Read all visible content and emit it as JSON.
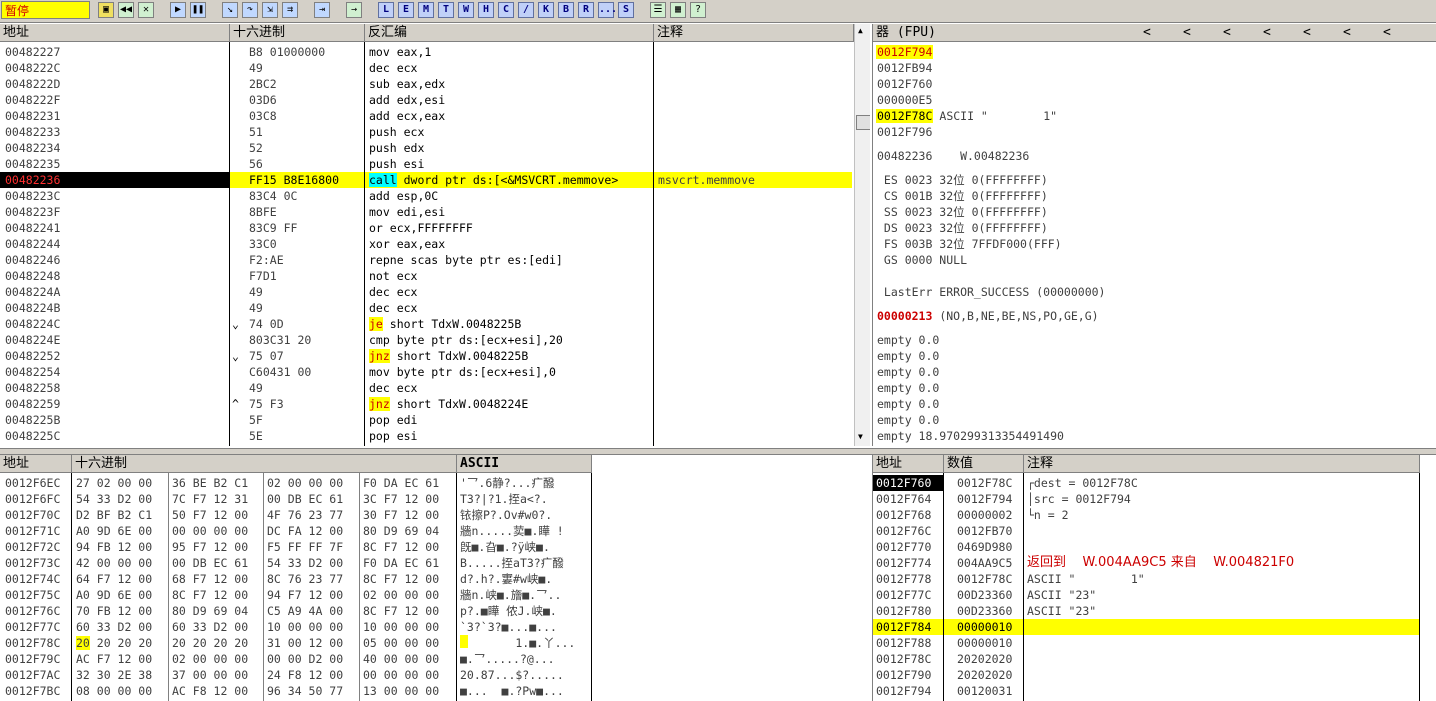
{
  "toolbar": {
    "status": "暂停",
    "letter_buttons": [
      "L",
      "E",
      "M",
      "T",
      "W",
      "H",
      "C",
      "/",
      "K",
      "B",
      "R",
      "...",
      "S"
    ]
  },
  "disasm": {
    "headers": {
      "addr": "地址",
      "hex": "十六进制",
      "asm": "反汇编",
      "comment": "注释"
    },
    "rows": [
      {
        "addr": "00482227",
        "mark": "",
        "hex": "B8 01000000",
        "op": "",
        "asm": "mov eax,1",
        "comment": ""
      },
      {
        "addr": "0048222C",
        "mark": "",
        "hex": "49",
        "op": "",
        "asm": "dec ecx",
        "comment": ""
      },
      {
        "addr": "0048222D",
        "mark": "",
        "hex": "2BC2",
        "op": "",
        "asm": "sub eax,edx",
        "comment": ""
      },
      {
        "addr": "0048222F",
        "mark": "",
        "hex": "03D6",
        "op": "",
        "asm": "add edx,esi",
        "comment": ""
      },
      {
        "addr": "00482231",
        "mark": "",
        "hex": "03C8",
        "op": "",
        "asm": "add ecx,eax",
        "comment": ""
      },
      {
        "addr": "00482233",
        "mark": "",
        "hex": "51",
        "op": "",
        "asm": "push ecx",
        "comment": ""
      },
      {
        "addr": "00482234",
        "mark": "",
        "hex": "52",
        "op": "",
        "asm": "push edx",
        "comment": ""
      },
      {
        "addr": "00482235",
        "mark": "",
        "hex": "56",
        "op": "",
        "asm": "push esi",
        "comment": ""
      },
      {
        "addr": "00482236",
        "mark": "",
        "hex": "FF15 B8E16800",
        "op": "call",
        "asm": " dword ptr ds:[<&MSVCRT.memmove>",
        "comment": "msvcrt.memmove"
      },
      {
        "addr": "0048223C",
        "mark": "",
        "hex": "83C4 0C",
        "op": "",
        "asm": "add esp,0C",
        "comment": ""
      },
      {
        "addr": "0048223F",
        "mark": "",
        "hex": "8BFE",
        "op": "",
        "asm": "mov edi,esi",
        "comment": ""
      },
      {
        "addr": "00482241",
        "mark": "",
        "hex": "83C9 FF",
        "op": "",
        "asm": "or ecx,FFFFFFFF",
        "comment": ""
      },
      {
        "addr": "00482244",
        "mark": "",
        "hex": "33C0",
        "op": "",
        "asm": "xor eax,eax",
        "comment": ""
      },
      {
        "addr": "00482246",
        "mark": "",
        "hex": "F2:AE",
        "op": "",
        "asm": "repne scas byte ptr es:[edi]",
        "comment": ""
      },
      {
        "addr": "00482248",
        "mark": "",
        "hex": "F7D1",
        "op": "",
        "asm": "not ecx",
        "comment": ""
      },
      {
        "addr": "0048224A",
        "mark": "",
        "hex": "49",
        "op": "",
        "asm": "dec ecx",
        "comment": ""
      },
      {
        "addr": "0048224B",
        "mark": "",
        "hex": "49",
        "op": "",
        "asm": "dec ecx",
        "comment": ""
      },
      {
        "addr": "0048224C",
        "mark": "⌄",
        "hex": "74 0D",
        "op": "je",
        "asm": " short TdxW.0048225B",
        "comment": ""
      },
      {
        "addr": "0048224E",
        "mark": "",
        "hex": "803C31 20",
        "op": "",
        "asm": "cmp byte ptr ds:[ecx+esi],20",
        "comment": ""
      },
      {
        "addr": "00482252",
        "mark": "⌄",
        "hex": "75 07",
        "op": "jnz",
        "asm": " short TdxW.0048225B",
        "comment": ""
      },
      {
        "addr": "00482254",
        "mark": "",
        "hex": "C60431 00",
        "op": "",
        "asm": "mov byte ptr ds:[ecx+esi],0",
        "comment": ""
      },
      {
        "addr": "00482258",
        "mark": "",
        "hex": "49",
        "op": "",
        "asm": "dec ecx",
        "comment": ""
      },
      {
        "addr": "00482259",
        "mark": "^",
        "hex": "75 F3",
        "op": "jnz",
        "asm": " short TdxW.0048224E",
        "comment": ""
      },
      {
        "addr": "0048225B",
        "mark": "",
        "hex": "5F",
        "op": "",
        "asm": "pop edi",
        "comment": ""
      },
      {
        "addr": "0048225C",
        "mark": "",
        "hex": "5E",
        "op": "",
        "asm": "pop esi",
        "comment": ""
      }
    ]
  },
  "registers": {
    "title": "器 (FPU)",
    "arrows": [
      "<",
      "<",
      "<",
      "<",
      "<",
      "<",
      "<"
    ],
    "top_values": [
      {
        "val": "0012F794",
        "note": ""
      },
      {
        "val": "0012FB94",
        "note": ""
      },
      {
        "val": "0012F760",
        "note": ""
      },
      {
        "val": "000000E5",
        "note": ""
      },
      {
        "val": "0012F78C",
        "note": "ASCII \"        1\""
      },
      {
        "val": "0012F796",
        "note": ""
      }
    ],
    "eip_line": "00482236    W.00482236",
    "segments": [
      " ES 0023 32位 0(FFFFFFFF)",
      " CS 001B 32位 0(FFFFFFFF)",
      " SS 0023 32位 0(FFFFFFFF)",
      " DS 0023 32位 0(FFFFFFFF)",
      " FS 003B 32位 7FFDF000(FFF)",
      " GS 0000 NULL"
    ],
    "lasterr": " LastErr ERROR_SUCCESS (00000000)",
    "eflags_val": "00000213",
    "eflags_text": " (NO,B,NE,BE,NS,PO,GE,G)",
    "fpu": [
      "empty 0.0",
      "empty 0.0",
      "empty 0.0",
      "empty 0.0",
      "empty 0.0",
      "empty 0.0",
      "empty 18.970299313354491490"
    ]
  },
  "dump": {
    "headers": {
      "addr": "地址",
      "hex": "十六进制",
      "ascii": "ASCII"
    },
    "rows": [
      {
        "addr": "0012F6EC",
        "b": [
          "27 02 00 00",
          "36 BE B2 C1",
          "02 00 00 00",
          "F0 DA EC 61"
        ],
        "ascii": "'乛.6静?...疒醱"
      },
      {
        "addr": "0012F6FC",
        "b": [
          "54 33 D2 00",
          "7C F7 12 31",
          "00 DB EC 61",
          "3C F7 12 00"
        ],
        "ascii": "T3?|?1.挃a<?."
      },
      {
        "addr": "0012F70C",
        "b": [
          "D2 BF B2 C1",
          "50 F7 12 00",
          "4F 76 23 77",
          "30 F7 12 00"
        ],
        "ascii": "铱擦P?.Ov#w0?."
      },
      {
        "addr": "0012F71C",
        "b": [
          "A0 9D 6E 00",
          "00 00 00 00",
          "DC FA 12 00",
          "80 D9 69 04"
        ],
        "ascii": "牆n.....荬■.瞱 !"
      },
      {
        "addr": "0012F72C",
        "b": [
          "94 FB 12 00",
          "95 F7 12 00",
          "F5 FF FF 7F",
          "8C F7 12 00"
        ],
        "ascii": "旣■.旮■.?ÿ峡■."
      },
      {
        "addr": "0012F73C",
        "b": [
          "42 00 00 00",
          "00 DB EC 61",
          "54 33 D2 00",
          "F0 DA EC 61"
        ],
        "ascii": "B.....挃aT3?疒醱"
      },
      {
        "addr": "0012F74C",
        "b": [
          "64 F7 12 00",
          "68 F7 12 00",
          "8C 76 23 77",
          "8C F7 12 00"
        ],
        "ascii": "d?.h?.寠#w峡■."
      },
      {
        "addr": "0012F75C",
        "b": [
          "A0 9D 6E 00",
          "8C F7 12 00",
          "94 F7 12 00",
          "02 00 00 00"
        ],
        "ascii": "牆n.峡■.旝■.乛.."
      },
      {
        "addr": "0012F76C",
        "b": [
          "70 FB 12 00",
          "80 D9 69 04",
          "C5 A9 4A 00",
          "8C F7 12 00"
        ],
        "ascii": "p?.■瞱 侬J.峡■."
      },
      {
        "addr": "0012F77C",
        "b": [
          "60 33 D2 00",
          "60 33 D2 00",
          "10 00 00 00",
          "10 00 00 00"
        ],
        "ascii": "`3?`3?■...■..."
      },
      {
        "addr": "0012F78C",
        "b": [
          "20 20 20 20",
          "20 20 20 20",
          "31 00 12 00",
          "05 00 00 00"
        ],
        "ascii": "        1.■.丫..."
      },
      {
        "addr": "0012F79C",
        "b": [
          "AC F7 12 00",
          "02 00 00 00",
          "00 00 D2 00",
          "40 00 00 00"
        ],
        "ascii": "■.乛.....?@..."
      },
      {
        "addr": "0012F7AC",
        "b": [
          "32 30 2E 38",
          "37 00 00 00",
          "24 F8 12 00",
          "00 00 00 00"
        ],
        "ascii": "20.87...$?....."
      },
      {
        "addr": "0012F7BC",
        "b": [
          "08 00 00 00",
          "AC F8 12 00",
          "96 34 50 77",
          "13 00 00 00"
        ],
        "ascii": "■...  ■.?Pw■..."
      }
    ]
  },
  "stack": {
    "headers": {
      "addr": "地址",
      "val": "数值",
      "comment": "注释"
    },
    "rows": [
      {
        "addr": "0012F760",
        "val": "0012F78C",
        "comment": "┌dest = 0012F78C"
      },
      {
        "addr": "0012F764",
        "val": "0012F794",
        "comment": "│src = 0012F794"
      },
      {
        "addr": "0012F768",
        "val": "00000002",
        "comment": "└n = 2"
      },
      {
        "addr": "0012F76C",
        "val": "0012FB70",
        "comment": ""
      },
      {
        "addr": "0012F770",
        "val": "0469D980",
        "comment": ""
      },
      {
        "addr": "0012F774",
        "val": "004AA9C5",
        "comment": "返回到    W.004AA9C5 来自    W.004821F0"
      },
      {
        "addr": "0012F778",
        "val": "0012F78C",
        "comment": "ASCII \"        1\""
      },
      {
        "addr": "0012F77C",
        "val": "00D23360",
        "comment": "ASCII \"23\""
      },
      {
        "addr": "0012F780",
        "val": "00D23360",
        "comment": "ASCII \"23\""
      },
      {
        "addr": "0012F784",
        "val": "00000010",
        "comment": ""
      },
      {
        "addr": "0012F788",
        "val": "00000010",
        "comment": ""
      },
      {
        "addr": "0012F78C",
        "val": "20202020",
        "comment": ""
      },
      {
        "addr": "0012F790",
        "val": "20202020",
        "comment": ""
      },
      {
        "addr": "0012F794",
        "val": "00120031",
        "comment": ""
      }
    ]
  }
}
